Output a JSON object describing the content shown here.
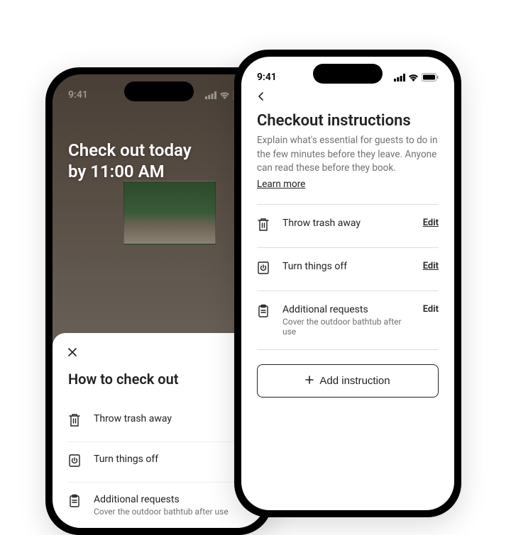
{
  "status": {
    "time": "9:41"
  },
  "guest": {
    "hero_line1": "Check out today",
    "hero_line2": "by 11:00 AM",
    "sheet_title": "How to check out",
    "items": [
      {
        "label": "Throw trash away",
        "sub": ""
      },
      {
        "label": "Turn things off",
        "sub": ""
      },
      {
        "label": "Additional requests",
        "sub": "Cover the outdoor bathtub after use"
      }
    ]
  },
  "host": {
    "title": "Checkout instructions",
    "desc": "Explain what's essential for guests to do in the few minutes before they leave. Anyone can read these before they book.",
    "learn_more": "Learn more",
    "items": [
      {
        "label": "Throw trash away",
        "sub": "",
        "action": "Edit"
      },
      {
        "label": "Turn things off",
        "sub": "",
        "action": "Edit"
      },
      {
        "label": "Additional requests",
        "sub": "Cover the outdoor bathtub after use",
        "action": "Edit"
      }
    ],
    "add_label": "Add instruction"
  }
}
